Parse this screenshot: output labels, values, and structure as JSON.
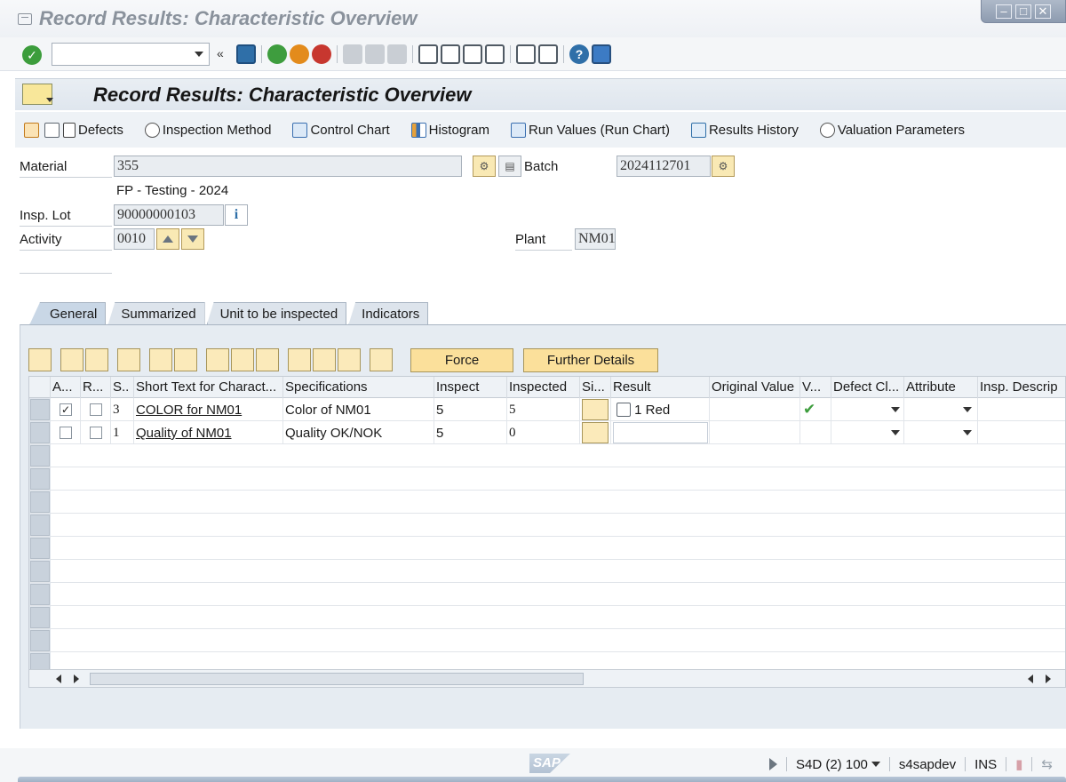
{
  "window": {
    "title": "Record Results: Characteristic Overview"
  },
  "system_toolbar": {
    "command_value": "",
    "double_arrow": "«"
  },
  "screen": {
    "title": "Record Results: Characteristic Overview"
  },
  "app_toolbar": {
    "items": [
      {
        "label": "Defects",
        "icon": "document-icon"
      },
      {
        "label": "Inspection Method",
        "icon": "inspection-method-icon"
      },
      {
        "label": "Control Chart",
        "icon": "control-chart-icon"
      },
      {
        "label": "Histogram",
        "icon": "histogram-icon"
      },
      {
        "label": "Run Values (Run Chart)",
        "icon": "run-chart-icon"
      },
      {
        "label": "Results History",
        "icon": "results-history-icon"
      },
      {
        "label": "Valuation Parameters",
        "icon": "valuation-parameters-icon"
      }
    ]
  },
  "header": {
    "material_label": "Material",
    "material_value": "355",
    "material_desc": "FP - Testing - 2024",
    "batch_label": "Batch",
    "batch_value": "2024112701",
    "insp_lot_label": "Insp. Lot",
    "insp_lot_value": "90000000103",
    "activity_label": "Activity",
    "activity_value": "0010",
    "plant_label": "Plant",
    "plant_value": "NM01"
  },
  "tabs": [
    {
      "label": "General",
      "active": true
    },
    {
      "label": "Summarized",
      "active": false
    },
    {
      "label": "Unit to be inspected",
      "active": false
    },
    {
      "label": "Indicators",
      "active": false
    }
  ],
  "table_toolbar": {
    "force_label": "Force",
    "further_details_label": "Further Details"
  },
  "table": {
    "columns": [
      "A...",
      "R...",
      "S..",
      "Short Text for Charact...",
      "Specifications",
      "Inspect",
      "Inspected",
      "Si...",
      "Result",
      "Original Value",
      "V...",
      "Defect Cl...",
      "Attribute",
      "Insp. Descrip"
    ],
    "rows": [
      {
        "a_checked": true,
        "r_checked": false,
        "s": "3",
        "short_text": "COLOR for NM01",
        "spec": "Color of NM01",
        "inspect": "5",
        "inspected": "5",
        "result": "1 Red",
        "original_value": "",
        "valuation": "✔",
        "defect_class": "",
        "attribute": "",
        "insp_desc": ""
      },
      {
        "a_checked": false,
        "r_checked": false,
        "s": "1",
        "short_text": "Quality of NM01",
        "spec": "Quality OK/NOK",
        "inspect": "5",
        "inspected": "0",
        "result": "",
        "original_value": "",
        "valuation": "",
        "defect_class": "",
        "attribute": "",
        "insp_desc": ""
      }
    ]
  },
  "status_bar": {
    "logo": "SAP",
    "system": "S4D (2) 100",
    "server": "s4sapdev",
    "mode": "INS"
  },
  "colors": {
    "button_yellow": "#fbe09b",
    "header_blue": "#dfe6ee",
    "valuation_green": "#3e9d3e"
  }
}
